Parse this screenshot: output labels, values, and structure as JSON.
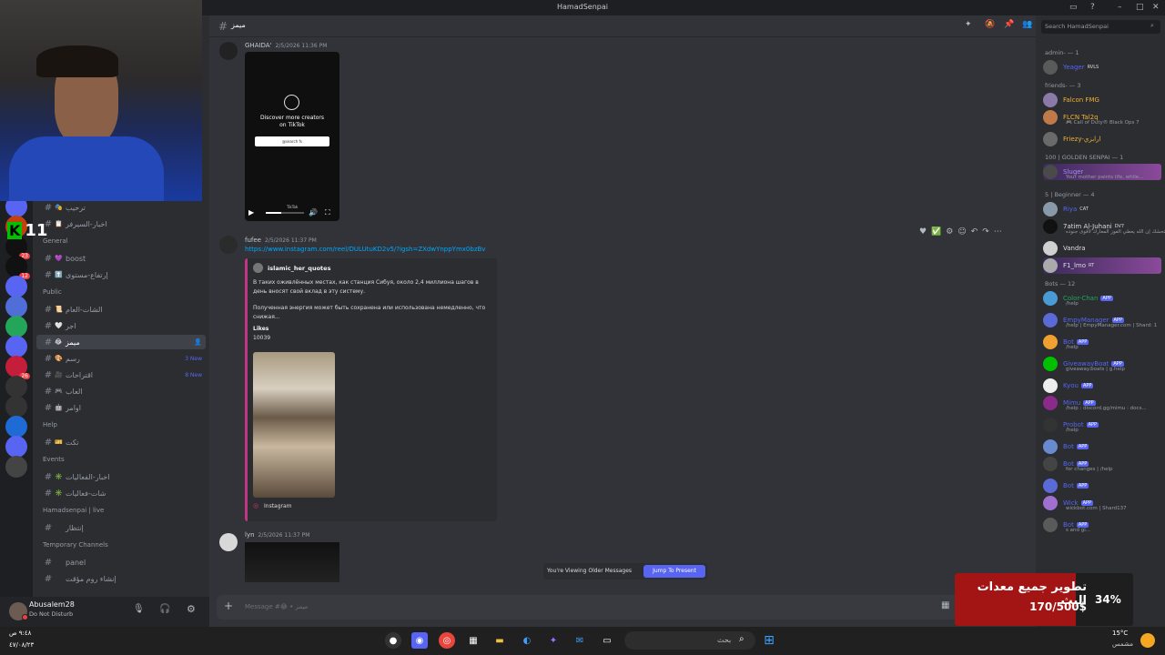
{
  "window": {
    "title": "HamadSenpai"
  },
  "channel_header": {
    "name": "ميمز",
    "search_placeholder": "Search HamadSenpai"
  },
  "webcam": {
    "number": "11"
  },
  "sidebar": {
    "top_channels": [
      {
        "emoji": "🎭",
        "name": "ترحيب"
      },
      {
        "emoji": "📋",
        "name": "اخبار-السيرفر"
      }
    ],
    "categories": [
      {
        "name": "General",
        "channels": [
          {
            "emoji": "💜",
            "name": "boost"
          },
          {
            "emoji": "⬆️",
            "name": "إرتفاع-مستوى"
          }
        ]
      },
      {
        "name": "Public",
        "channels": [
          {
            "emoji": "📜",
            "name": "الشات-العام"
          },
          {
            "emoji": "🤍",
            "name": "اجر"
          },
          {
            "emoji": "😂",
            "name": "ميمز",
            "selected": true
          },
          {
            "emoji": "🎨",
            "name": "رسم",
            "new": "3 New"
          },
          {
            "emoji": "🎥",
            "name": "اقتراحات",
            "new": "8 New"
          },
          {
            "emoji": "🎮",
            "name": "العاب"
          },
          {
            "emoji": "🤖",
            "name": "اوامر"
          }
        ]
      },
      {
        "name": "Help",
        "channels": [
          {
            "emoji": "🎫",
            "name": "تكت"
          }
        ]
      },
      {
        "name": "Events",
        "channels": [
          {
            "emoji": "✳️",
            "name": "اخبار-الفعاليات"
          },
          {
            "emoji": "✳️",
            "name": "شات-فعاليات"
          }
        ]
      },
      {
        "name": "Hamadsenpai | live",
        "channels": [
          {
            "emoji": "",
            "name": "إنتظار"
          }
        ]
      },
      {
        "name": "Temporary Channels",
        "channels": [
          {
            "emoji": "",
            "name": "panel"
          },
          {
            "emoji": "",
            "name": "إنشاء روم مؤقت"
          }
        ]
      }
    ]
  },
  "servers": [
    {
      "badge": ""
    },
    {
      "badge": ""
    },
    {
      "badge": "23"
    },
    {
      "badge": "12"
    },
    {
      "badge": ""
    },
    {
      "badge": ""
    },
    {
      "badge": ""
    },
    {
      "badge": ""
    },
    {
      "badge": "26"
    },
    {
      "badge": ""
    },
    {
      "badge": ""
    },
    {
      "badge": ""
    },
    {
      "badge": ""
    },
    {
      "badge": ""
    }
  ],
  "user": {
    "name": "Abusalem28",
    "status": "Do Not Disturb"
  },
  "messages": [
    {
      "author": "GHAIDA'",
      "time": "2/5/2026 11:36 PM",
      "video": {
        "line1": "Discover more creators",
        "line2": "on TikTok",
        "search": "@search fs",
        "brand": "TikTok"
      }
    },
    {
      "author": "fufee",
      "time": "2/5/2026 11:37 PM",
      "link": "https://www.instagram.com/reel/DULUtuKD2v5/?igsh=ZXdwYnppYmx0bzBv",
      "embed": {
        "author": "islamic_her_quotes",
        "text1": "В таких оживлённых местах, как станция Сибуя, около 2,4 миллиона шагов в день вносят свой вклад в эту систему.",
        "text2": "Полученная энергия может быть сохранена или использована немедленно, что снижая...",
        "likes_label": "Likes",
        "likes": "10039",
        "footer": "Instagram"
      }
    },
    {
      "author": "lyn",
      "time": "2/5/2026 11:37 PM"
    }
  ],
  "older_bar": {
    "text": "You're Viewing Older Messages",
    "button": "Jump To Present"
  },
  "composer": {
    "placeholder": "Message #😂 • ميمز"
  },
  "members": {
    "groups": [
      {
        "title": "admin- — 1",
        "items": [
          {
            "name": "Yeager",
            "tag": "RVLS",
            "color": "#5865f2",
            "sub": ""
          }
        ]
      },
      {
        "title": "friends- — 3",
        "items": [
          {
            "name": "Falcon FMG",
            "color": "#f0b232",
            "sub": ""
          },
          {
            "name": "FLCN Tal2q",
            "color": "#f0b232",
            "sub": "🎮 Call of Duty® Black Ops 7"
          },
          {
            "name": "Friezy-ارابزي",
            "color": "#f0b232",
            "sub": ""
          }
        ]
      },
      {
        "title": "100 | GOLDEN SENPAI — 1",
        "items": [
          {
            "name": "Sluger",
            "color": "#a78bfa",
            "sub": "Your mother paints life, while..."
          }
        ]
      },
      {
        "title": "5 | Beginner — 4",
        "items": [
          {
            "name": "Riya",
            "tag": "CAT",
            "color": "#5865f2",
            "sub": ""
          },
          {
            "name": "7atim Al-Juhani",
            "tag": "DV7",
            "color": "#dbdee1",
            "sub": "ستحشك إن الله يعطي الفوز المعارك لأقوى جنوده"
          },
          {
            "name": "Vandra",
            "color": "#dbdee1",
            "sub": ""
          },
          {
            "name": "F1_lmo",
            "tag": "RT",
            "color": "#dbdee1",
            "sub": ""
          }
        ]
      },
      {
        "title": "Bots — 12",
        "items": [
          {
            "name": "Color-Chan",
            "app": "APP",
            "color": "#23a55a",
            "sub": "/help"
          },
          {
            "name": "EmpyManager",
            "app": "APP",
            "color": "#5865f2",
            "sub": "/help | EmpyManager.com | Shard: 1"
          },
          {
            "name": "Bot",
            "app": "APP",
            "color": "#5865f2",
            "sub": "/help"
          },
          {
            "name": "GiveawayBoat",
            "app": "APP",
            "color": "#5865f2",
            "sub": "giveaway.boats | g.help"
          },
          {
            "name": "Kyou",
            "app": "APP",
            "color": "#5865f2",
            "sub": ""
          },
          {
            "name": "Mimu",
            "app": "APP",
            "color": "#5865f2",
            "sub": "/help : discord.gg/mimu : docs..."
          },
          {
            "name": "Probot",
            "app": "APP",
            "color": "#5865f2",
            "sub": "/help"
          },
          {
            "name": "Bot",
            "app": "APP",
            "color": "#5865f2",
            "sub": ""
          },
          {
            "name": "Bot",
            "app": "APP",
            "color": "#5865f2",
            "sub": "for changes | /help"
          },
          {
            "name": "Bot",
            "app": "APP",
            "color": "#5865f2",
            "sub": ""
          },
          {
            "name": "Wick",
            "app": "APP",
            "color": "#5865f2",
            "sub": "wickbot.com | Shard137"
          },
          {
            "name": "Bot",
            "app": "APP",
            "color": "#5865f2",
            "sub": "s and gi..."
          }
        ]
      }
    ]
  },
  "goal": {
    "title": "تطوير جميع معدات البث",
    "amount": "170/500$",
    "percent": "34%",
    "progress": 0.34
  },
  "taskbar": {
    "search": "بحث",
    "weather_temp": "15°C",
    "weather_desc": "مشمس",
    "time": "٩:٤٨ ص",
    "date": "٤٧/٠٨/٢٣"
  }
}
